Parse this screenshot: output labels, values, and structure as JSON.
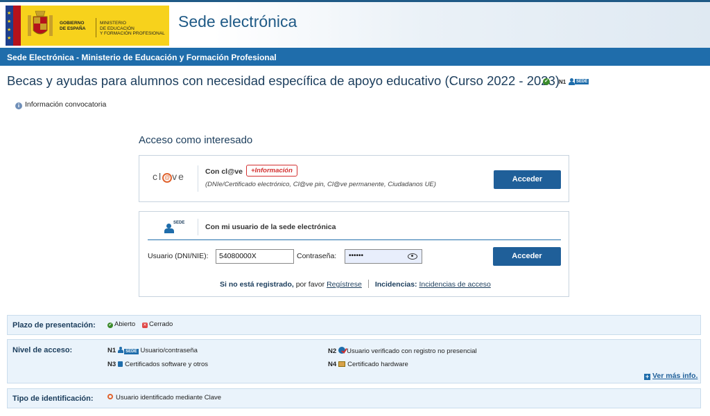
{
  "header": {
    "gov_text": "GOBIERNO\nDE ESPAÑA",
    "ministry_text": "MINISTERIO\nDE EDUCACIÓN\nY FORMACIÓN PROFESIONAL",
    "site_title": "Sede electrónica"
  },
  "bluebar": {
    "title": "Sede Electrónica - Ministerio de Educación y Formación Profesional"
  },
  "page": {
    "title": "Becas y ayudas para alumnos con necesidad específica de apoyo educativo (Curso 2022 - 2023)",
    "level_badge": "N1",
    "sede_tag": "SEDE",
    "info_link": "Información convocatoria"
  },
  "access": {
    "title": "Acceso como interesado",
    "clave": {
      "logo_left": "cl",
      "logo_at": "@",
      "logo_right": "ve",
      "label": "Con cl@ve",
      "info_badge": "+Información",
      "description": "(DNIe/Certificado electrónico, Cl@ve pin, Cl@ve permanente, Ciudadanos UE)",
      "button": "Acceder"
    },
    "sede": {
      "logo_tag": "SEDE",
      "label": "Con mi usuario de la sede electrónica",
      "user_label": "Usuario (DNI/NIE):",
      "user_value": "54080000X",
      "password_label": "Contraseña:",
      "password_value": "••••••",
      "button": "Acceder",
      "not_registered_bold": "Si no está registrado,",
      "not_registered_text": " por favor ",
      "register_link": "Regístrese",
      "incidents_label": "Incidencias:",
      "incidents_link": "Incidencias de acceso"
    }
  },
  "panels": {
    "plazo": {
      "label": "Plazo de presentación:",
      "open": "Abierto",
      "closed": "Cerrado"
    },
    "nivel": {
      "label": "Nivel de acceso:",
      "n1_level": "N1",
      "n1_tag": "SEDE",
      "n1_text": "Usuario/contraseña",
      "n2_level": "N2",
      "n2_text": "Usuario verificado con registro no presencial",
      "n3_level": "N3",
      "n3_text": "Certificados software y otros",
      "n4_level": "N4",
      "n4_text": "Certificado hardware",
      "more_link": "Ver más info."
    },
    "tipo": {
      "label": "Tipo de identificación:",
      "value": "Usuario identificado mediante Clave"
    }
  },
  "colors": {
    "primary": "#1f6dab",
    "button": "#1f5f99",
    "title": "#1b3d5c",
    "badge_red": "#d32f2f",
    "clave_orange": "#e0632e",
    "gov_yellow": "#f7d21c"
  }
}
